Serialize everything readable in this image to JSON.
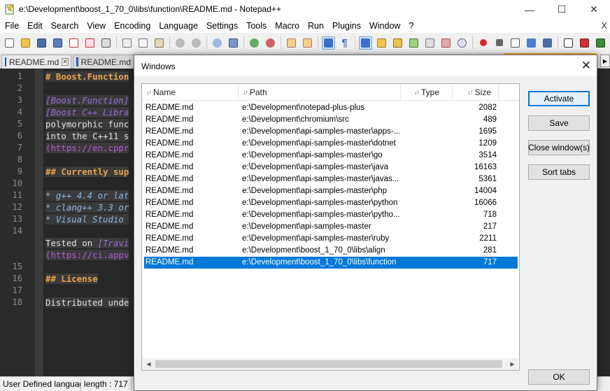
{
  "window": {
    "title": "e:\\Development\\boost_1_70_0\\libs\\function\\README.md - Notepad++",
    "min": "—",
    "max": "☐",
    "close": "✕"
  },
  "menu": {
    "items": [
      "File",
      "Edit",
      "Search",
      "View",
      "Encoding",
      "Language",
      "Settings",
      "Tools",
      "Macro",
      "Run",
      "Plugins",
      "Window",
      "?"
    ],
    "close": "X"
  },
  "tabs": [
    {
      "label": "README.md",
      "close": "✕"
    },
    {
      "label": "README.md"
    }
  ],
  "editor": {
    "line_numbers": [
      "1",
      "2",
      "3",
      "4",
      "5",
      "6",
      "7",
      "8",
      "9",
      "10",
      "11",
      "12",
      "13",
      "14",
      "15",
      "16",
      "17",
      "18"
    ],
    "lines": {
      "l1": "# Boost.Function",
      "l3": "[Boost.Function]",
      "l4": "[Boost C++ Libra",
      "l5a": "polymorphic",
      "l5b": "func",
      "l6a": "into",
      "l6b": "the",
      "l6c": "C++11",
      "l6d": "s",
      "l7": "(https://en.cppr",
      "l9": "## Currently sup",
      "l11": "* g++ 4.4 or lat",
      "l12": "* clang++ 3.3 or",
      "l13": "* Visual Studio ",
      "l15a": "Tested",
      "l15b": "on",
      "l15c": "[Travi",
      "l16": "(https://ci.appv",
      "l18": "## License",
      "l20a": "Distributed",
      "l20b": "unde"
    }
  },
  "status": {
    "language": "User Defined languag",
    "length": "length : 717"
  },
  "dialog": {
    "title": "Windows",
    "close": "✕",
    "columns": {
      "name": "Name",
      "path": "Path",
      "type": "Type",
      "size": "Size",
      "sort_glyph": "↓↑"
    },
    "rows": [
      {
        "name": "README.md",
        "path": "e:\\Development\\notepad-plus-plus",
        "type": "",
        "size": "2082"
      },
      {
        "name": "README.md",
        "path": "e:\\Development\\chromium\\src",
        "type": "",
        "size": "489"
      },
      {
        "name": "README.md",
        "path": "e:\\Development\\api-samples-master\\apps-...",
        "type": "",
        "size": "1695"
      },
      {
        "name": "README.md",
        "path": "e:\\Development\\api-samples-master\\dotnet",
        "type": "",
        "size": "1209"
      },
      {
        "name": "README.md",
        "path": "e:\\Development\\api-samples-master\\go",
        "type": "",
        "size": "3514"
      },
      {
        "name": "README.md",
        "path": "e:\\Development\\api-samples-master\\java",
        "type": "",
        "size": "16163"
      },
      {
        "name": "README.md",
        "path": "e:\\Development\\api-samples-master\\javas...",
        "type": "",
        "size": "5361"
      },
      {
        "name": "README.md",
        "path": "e:\\Development\\api-samples-master\\php",
        "type": "",
        "size": "14004"
      },
      {
        "name": "README.md",
        "path": "e:\\Development\\api-samples-master\\python",
        "type": "",
        "size": "16066"
      },
      {
        "name": "README.md",
        "path": "e:\\Development\\api-samples-master\\pytho...",
        "type": "",
        "size": "718"
      },
      {
        "name": "README.md",
        "path": "e:\\Development\\api-samples-master",
        "type": "",
        "size": "217"
      },
      {
        "name": "README.md",
        "path": "e:\\Development\\api-samples-master\\ruby",
        "type": "",
        "size": "2211"
      },
      {
        "name": "README.md",
        "path": "e:\\Development\\boost_1_70_0\\libs\\align",
        "type": "",
        "size": "281"
      },
      {
        "name": "README.md",
        "path": "e:\\Development\\boost_1_70_0\\libs\\function",
        "type": "",
        "size": "717"
      }
    ],
    "selected_row": 13,
    "scroll_left": "◀",
    "scroll_right": "▶",
    "buttons": {
      "activate": "Activate",
      "save": "Save",
      "close_windows": "Close window(s)",
      "sort_tabs": "Sort tabs",
      "ok": "OK"
    }
  },
  "colors": {
    "selection": "#0078d7",
    "editor_bg": "#272727",
    "heading": "#e8a24a",
    "link": "#9a6dd8"
  }
}
